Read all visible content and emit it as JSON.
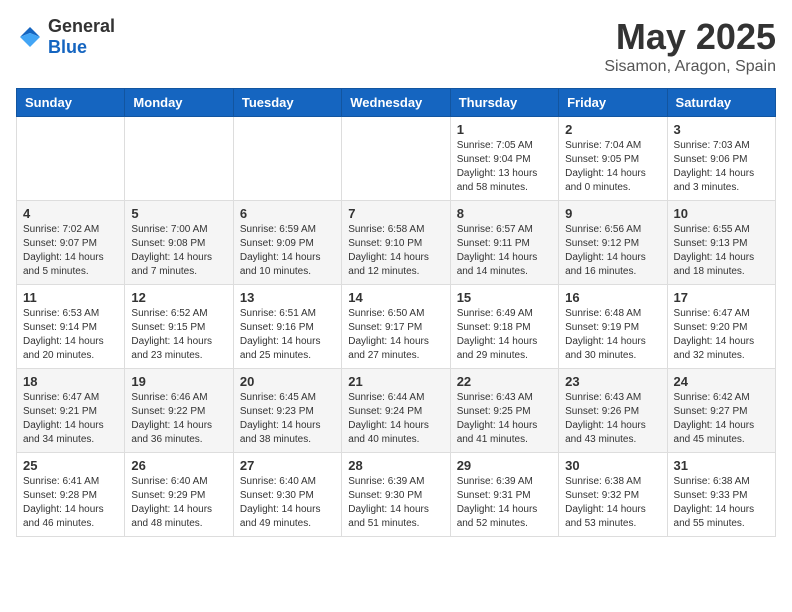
{
  "logo": {
    "general": "General",
    "blue": "Blue"
  },
  "title": "May 2025",
  "subtitle": "Sisamon, Aragon, Spain",
  "days_of_week": [
    "Sunday",
    "Monday",
    "Tuesday",
    "Wednesday",
    "Thursday",
    "Friday",
    "Saturday"
  ],
  "weeks": [
    [
      {
        "day": "",
        "info": ""
      },
      {
        "day": "",
        "info": ""
      },
      {
        "day": "",
        "info": ""
      },
      {
        "day": "",
        "info": ""
      },
      {
        "day": "1",
        "info": "Sunrise: 7:05 AM\nSunset: 9:04 PM\nDaylight: 13 hours and 58 minutes."
      },
      {
        "day": "2",
        "info": "Sunrise: 7:04 AM\nSunset: 9:05 PM\nDaylight: 14 hours and 0 minutes."
      },
      {
        "day": "3",
        "info": "Sunrise: 7:03 AM\nSunset: 9:06 PM\nDaylight: 14 hours and 3 minutes."
      }
    ],
    [
      {
        "day": "4",
        "info": "Sunrise: 7:02 AM\nSunset: 9:07 PM\nDaylight: 14 hours and 5 minutes."
      },
      {
        "day": "5",
        "info": "Sunrise: 7:00 AM\nSunset: 9:08 PM\nDaylight: 14 hours and 7 minutes."
      },
      {
        "day": "6",
        "info": "Sunrise: 6:59 AM\nSunset: 9:09 PM\nDaylight: 14 hours and 10 minutes."
      },
      {
        "day": "7",
        "info": "Sunrise: 6:58 AM\nSunset: 9:10 PM\nDaylight: 14 hours and 12 minutes."
      },
      {
        "day": "8",
        "info": "Sunrise: 6:57 AM\nSunset: 9:11 PM\nDaylight: 14 hours and 14 minutes."
      },
      {
        "day": "9",
        "info": "Sunrise: 6:56 AM\nSunset: 9:12 PM\nDaylight: 14 hours and 16 minutes."
      },
      {
        "day": "10",
        "info": "Sunrise: 6:55 AM\nSunset: 9:13 PM\nDaylight: 14 hours and 18 minutes."
      }
    ],
    [
      {
        "day": "11",
        "info": "Sunrise: 6:53 AM\nSunset: 9:14 PM\nDaylight: 14 hours and 20 minutes."
      },
      {
        "day": "12",
        "info": "Sunrise: 6:52 AM\nSunset: 9:15 PM\nDaylight: 14 hours and 23 minutes."
      },
      {
        "day": "13",
        "info": "Sunrise: 6:51 AM\nSunset: 9:16 PM\nDaylight: 14 hours and 25 minutes."
      },
      {
        "day": "14",
        "info": "Sunrise: 6:50 AM\nSunset: 9:17 PM\nDaylight: 14 hours and 27 minutes."
      },
      {
        "day": "15",
        "info": "Sunrise: 6:49 AM\nSunset: 9:18 PM\nDaylight: 14 hours and 29 minutes."
      },
      {
        "day": "16",
        "info": "Sunrise: 6:48 AM\nSunset: 9:19 PM\nDaylight: 14 hours and 30 minutes."
      },
      {
        "day": "17",
        "info": "Sunrise: 6:47 AM\nSunset: 9:20 PM\nDaylight: 14 hours and 32 minutes."
      }
    ],
    [
      {
        "day": "18",
        "info": "Sunrise: 6:47 AM\nSunset: 9:21 PM\nDaylight: 14 hours and 34 minutes."
      },
      {
        "day": "19",
        "info": "Sunrise: 6:46 AM\nSunset: 9:22 PM\nDaylight: 14 hours and 36 minutes."
      },
      {
        "day": "20",
        "info": "Sunrise: 6:45 AM\nSunset: 9:23 PM\nDaylight: 14 hours and 38 minutes."
      },
      {
        "day": "21",
        "info": "Sunrise: 6:44 AM\nSunset: 9:24 PM\nDaylight: 14 hours and 40 minutes."
      },
      {
        "day": "22",
        "info": "Sunrise: 6:43 AM\nSunset: 9:25 PM\nDaylight: 14 hours and 41 minutes."
      },
      {
        "day": "23",
        "info": "Sunrise: 6:43 AM\nSunset: 9:26 PM\nDaylight: 14 hours and 43 minutes."
      },
      {
        "day": "24",
        "info": "Sunrise: 6:42 AM\nSunset: 9:27 PM\nDaylight: 14 hours and 45 minutes."
      }
    ],
    [
      {
        "day": "25",
        "info": "Sunrise: 6:41 AM\nSunset: 9:28 PM\nDaylight: 14 hours and 46 minutes."
      },
      {
        "day": "26",
        "info": "Sunrise: 6:40 AM\nSunset: 9:29 PM\nDaylight: 14 hours and 48 minutes."
      },
      {
        "day": "27",
        "info": "Sunrise: 6:40 AM\nSunset: 9:30 PM\nDaylight: 14 hours and 49 minutes."
      },
      {
        "day": "28",
        "info": "Sunrise: 6:39 AM\nSunset: 9:30 PM\nDaylight: 14 hours and 51 minutes."
      },
      {
        "day": "29",
        "info": "Sunrise: 6:39 AM\nSunset: 9:31 PM\nDaylight: 14 hours and 52 minutes."
      },
      {
        "day": "30",
        "info": "Sunrise: 6:38 AM\nSunset: 9:32 PM\nDaylight: 14 hours and 53 minutes."
      },
      {
        "day": "31",
        "info": "Sunrise: 6:38 AM\nSunset: 9:33 PM\nDaylight: 14 hours and 55 minutes."
      }
    ]
  ]
}
